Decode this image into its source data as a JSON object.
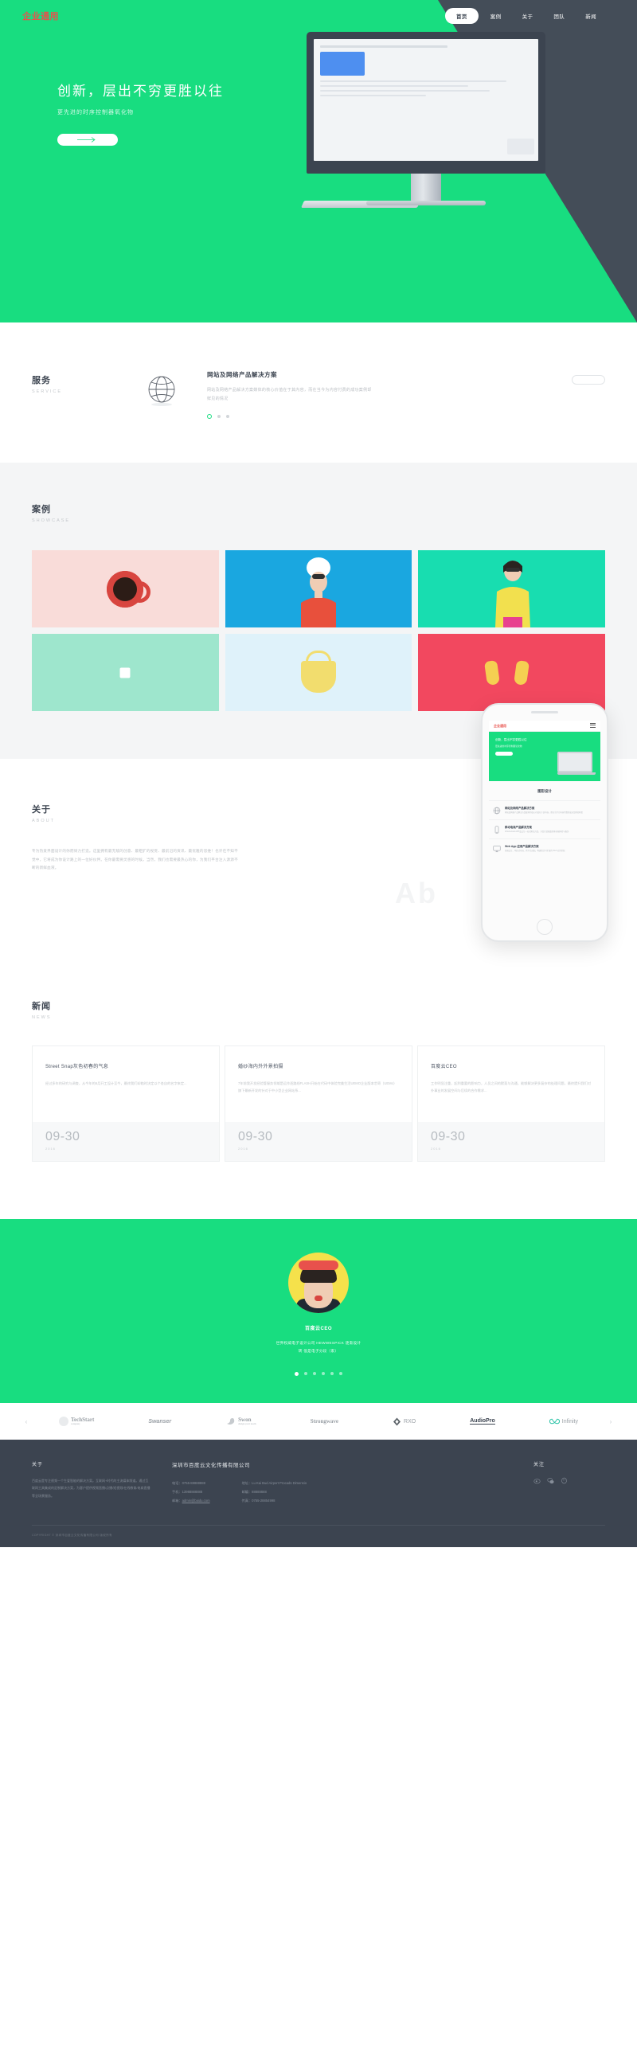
{
  "brand": {
    "logo": "企业通用",
    "accent": "#18dd80",
    "logo_color": "#e8514c",
    "dark": "#3c4450"
  },
  "nav": {
    "items": [
      {
        "label": "首页",
        "active": true
      },
      {
        "label": "案例",
        "active": false
      },
      {
        "label": "关于",
        "active": false
      },
      {
        "label": "团队",
        "active": false
      },
      {
        "label": "新闻",
        "active": false
      }
    ]
  },
  "hero": {
    "title": "创新，层出不穷更胜以往",
    "subtitle": "更先进的时序控制器氧化物",
    "button_icon": "arrow-right-icon"
  },
  "service": {
    "title": "服务",
    "subtitle": "SERVICE",
    "icon": "globe-icon",
    "item_title": "网站及网络产品解决方案",
    "item_desc": "网站及网络产品解决方案媒体的核心价值在于其内容，而在当今为内容付费的成功案例却鲜见的情况",
    "dots": 3,
    "active_dot": 0,
    "more_label": ""
  },
  "showcase": {
    "title": "案例",
    "subtitle": "SHOWCASE",
    "cells": [
      {
        "name": "coffee-cup",
        "bg": "#f9dcd9"
      },
      {
        "name": "woman-white-hat",
        "bg": "#1aa7e0"
      },
      {
        "name": "woman-yellow-jacket",
        "bg": "#18ddb0"
      },
      {
        "name": "white-square",
        "bg": "#9ee6cd"
      },
      {
        "name": "yellow-bag",
        "bg": "#dff2fa"
      },
      {
        "name": "yellow-shoes",
        "bg": "#f2485f"
      }
    ]
  },
  "about": {
    "title": "关于",
    "subtitle": "ABOUT",
    "ghost_text": "Ab",
    "body": "专为热爱界面设计的你而倾力打造。这里拥有最无敌的创意、最粗犷的视觉、最前沿的资讯、最优雅的思维！也许在不知不觉中，它将成为你设计路上的一位好伙伴。在你最需要灵感的时候，当然，我们也需要最热心的你，为我们平台注入源源不断的新鲜血液。",
    "phone": {
      "logo": "企业通用",
      "hero_title": "创新，层出不穷更胜以往",
      "hero_sub": "更先进的时序控制器氧化物",
      "section_title": "图形设计",
      "items": [
        {
          "icon": "globe-icon",
          "title": "网站及网络产品解决方案",
          "desc": "网站及网络产品解决方案媒体的核心价值在于其内容，而在当今为内容付费的成功案例却鲜见"
        },
        {
          "icon": "mobile-icon",
          "title": "移动电商产品解决方案",
          "desc": "iOS/Android APP及交互一站式解决方案，为您打造极致的移动端体验与服务"
        },
        {
          "icon": "desktop-icon",
          "title": "Web App 应用产品解决方案",
          "desc": "前端交互、响应式布局、跨平台适配，构建稳定可扩展的 Web 应用系统"
        }
      ]
    }
  },
  "news": {
    "title": "新闻",
    "subtitle": "NEWS",
    "cards": [
      {
        "title": "Street Snap灰色初春的气息",
        "excerpt": "经过多年的研究与调查，从今年的6月开工设计至今，最终我们却临时决定以个各自的名字来定...",
        "date": "09-30",
        "year": "2016"
      },
      {
        "title": "婚纱海内外外景拍摄",
        "excerpt": "7年前我开发经验管服务领域是运作逐路线FLASH开始在代码中体验完美生活UEMO企业版本芯寄（UEMo）旗下最新开发的针对于中小型企业网站系...",
        "date": "09-30",
        "year": "2016"
      },
      {
        "title": "百度云CEO",
        "excerpt": "工作明显注重，起到重要的影响力，人员之间的默契与沟通，能够解决更多复杂的处理问题，最终提升我们对外事业的发展空间与后续的合作需求...",
        "date": "09-30",
        "year": "2016"
      }
    ]
  },
  "testimonial": {
    "avatar": "woman-portrait-avatar",
    "name": "百度云CEO",
    "quote_line1": "世界权威电子设计公司 HEWWESPICK 逐渐设计",
    "quote_line2": "转 低是电子分段（家）",
    "dots": 6,
    "active_dot": 0
  },
  "partners": {
    "prev_icon": "chevron-left-icon",
    "next_icon": "chevron-right-icon",
    "logos": [
      {
        "name": "TechStart",
        "sub": "company",
        "style": "serif-circle"
      },
      {
        "name": "Swanser",
        "sub": "",
        "style": "italic"
      },
      {
        "name": "Swon",
        "sub": "design your mark",
        "style": "swan"
      },
      {
        "name": "Strongwave",
        "sub": "",
        "style": "serif"
      },
      {
        "name": "RXO",
        "sub": "",
        "style": "diamond"
      },
      {
        "name": "AudioPro",
        "sub": "",
        "style": "bold-underline"
      },
      {
        "name": "Infinity",
        "sub": "",
        "style": "infinity"
      }
    ]
  },
  "footer": {
    "about": {
      "heading": "关于",
      "body": "百度云是专注视频一个生爱智能的解决方案。互联网+时代的主流媒体频道。通过互联网工具集成的定制解决方案，为客户提供视频直播/点播/短视频/在线教育/电商直播等全场景服务。"
    },
    "company": {
      "name": "深圳市百度云文化传播有限公司",
      "left": [
        {
          "label": "电话：",
          "value": "0755-88888888"
        },
        {
          "label": "手机：",
          "value": "13988888888"
        },
        {
          "label": "邮箱：",
          "value": "admin@baidu.com",
          "is_link": true
        }
      ],
      "right": [
        {
          "label": "地址：",
          "value": "Lu Kai Bud Airport Procads Dimensio"
        },
        {
          "label": "邮编：",
          "value": "88888888"
        },
        {
          "label": "传真：",
          "value": "0755-28854998"
        }
      ]
    },
    "follow": {
      "heading": "关注",
      "icons": [
        "weibo-icon",
        "wechat-icon",
        "qq-icon"
      ]
    },
    "copyright": "COPYRIGHT © 深圳市百度云文化传播有限公司 版权所有"
  }
}
